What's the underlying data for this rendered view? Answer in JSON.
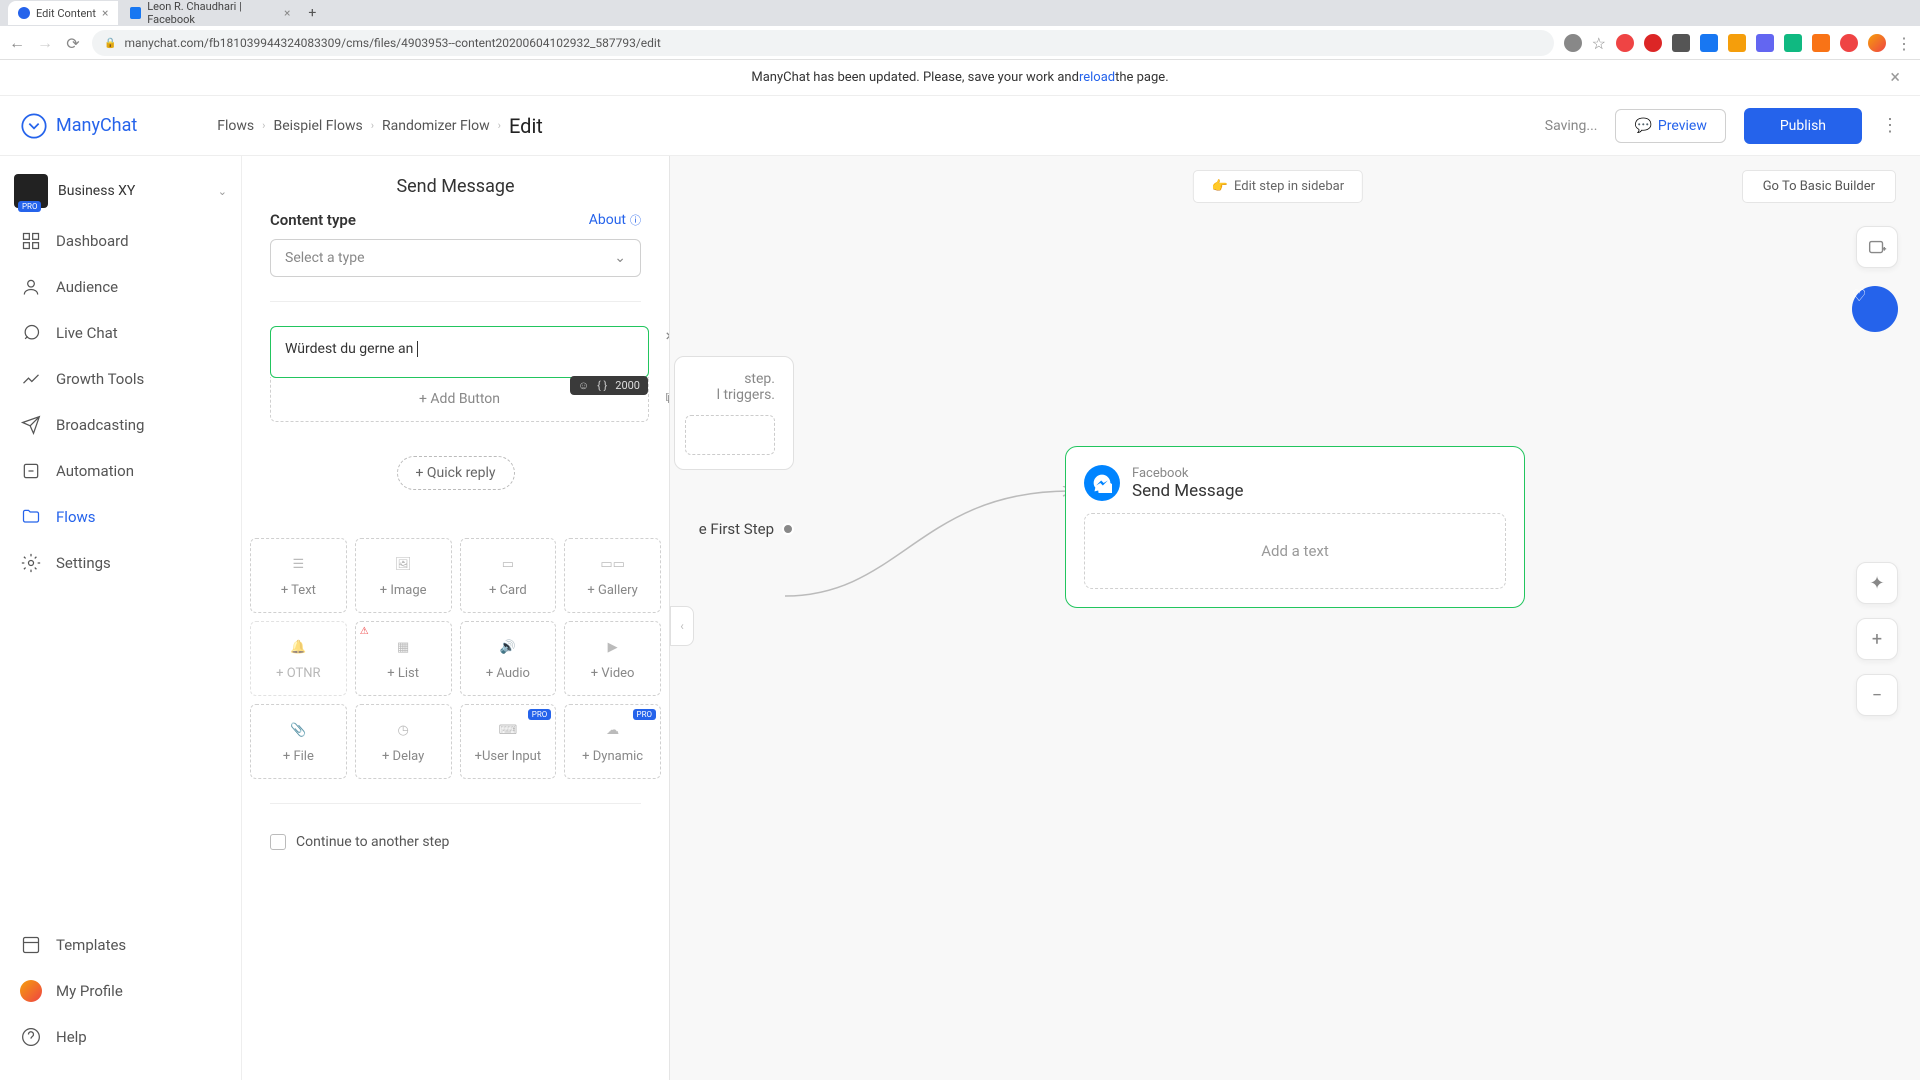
{
  "browser": {
    "tabs": [
      {
        "title": "Edit Content",
        "favicon": "manychat"
      },
      {
        "title": "Leon R. Chaudhari | Facebook",
        "favicon": "fb"
      }
    ],
    "url": "manychat.com/fb181039944324083309/cms/files/4903953--content20200604102932_587793/edit"
  },
  "notif": {
    "pre": "ManyChat has been updated. Please, save your work and ",
    "link": "reload",
    "post": " the page."
  },
  "header": {
    "brand": "ManyChat",
    "breadcrumb": [
      "Flows",
      "Beispiel Flows",
      "Randomizer Flow"
    ],
    "current": "Edit",
    "saving": "Saving...",
    "preview": "Preview",
    "publish": "Publish"
  },
  "account": {
    "name": "Business XY",
    "badge": "PRO"
  },
  "nav": {
    "dashboard": "Dashboard",
    "audience": "Audience",
    "livechat": "Live Chat",
    "growth": "Growth Tools",
    "broadcasting": "Broadcasting",
    "automation": "Automation",
    "flows": "Flows",
    "settings": "Settings",
    "templates": "Templates",
    "profile": "My Profile",
    "help": "Help"
  },
  "panel": {
    "title": "Send Message",
    "content_type": "Content type",
    "about": "About",
    "select_placeholder": "Select a type",
    "text_value": "Würdest du gerne an ",
    "char_limit": "2000",
    "add_button": "+ Add Button",
    "quick_reply": "+ Quick reply",
    "continue": "Continue to another step",
    "blocks": {
      "text": "+ Text",
      "image": "+ Image",
      "card": "+ Card",
      "gallery": "+ Gallery",
      "otnr": "+ OTNR",
      "list": "+ List",
      "audio": "+ Audio",
      "video": "+ Video",
      "file": "+ File",
      "delay": "+ Delay",
      "userinput": "+User Input",
      "dynamic": "+ Dynamic"
    }
  },
  "canvas": {
    "edit_sidebar": "Edit step in sidebar",
    "go_basic": "Go To Basic Builder",
    "ghost": {
      "line1": "step.",
      "line2": "l triggers.",
      "first_step": "e First Step"
    },
    "node": {
      "channel": "Facebook",
      "title": "Send Message",
      "placeholder": "Add a text"
    }
  }
}
